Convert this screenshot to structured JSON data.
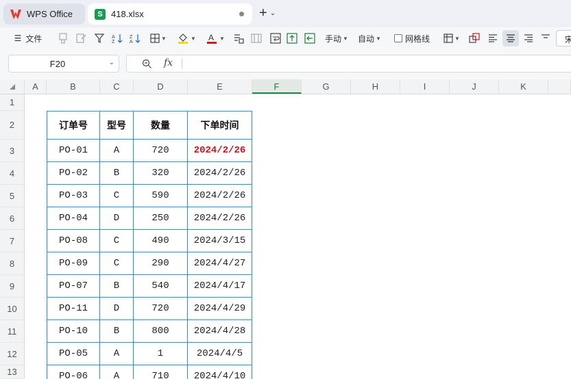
{
  "tabs": {
    "app_label": "WPS Office",
    "file_label": "418.xlsx",
    "file_icon": "S",
    "new_tab": "+"
  },
  "toolbar": {
    "file_menu": "文件",
    "manual": "手动",
    "auto": "自动",
    "gridlines": "网格线",
    "font_partial": "宋",
    "fill_color": "#f5d90a",
    "font_color": "#d0101a"
  },
  "formula_bar": {
    "name_box": "F20",
    "fx": "fx",
    "value": ""
  },
  "columns": [
    "A",
    "B",
    "C",
    "D",
    "E",
    "F",
    "G",
    "H",
    "I",
    "J",
    "K"
  ],
  "active_column": "F",
  "rows": [
    "1",
    "2",
    "3",
    "4",
    "5",
    "6",
    "7",
    "8",
    "9",
    "10",
    "11",
    "12",
    "13"
  ],
  "table": {
    "headers": [
      "订单号",
      "型号",
      "数量",
      "下单时间"
    ],
    "rows": [
      [
        "PO-01",
        "A",
        "720",
        "2024/2/26"
      ],
      [
        "PO-02",
        "B",
        "320",
        "2024/2/26"
      ],
      [
        "PO-03",
        "C",
        "590",
        "2024/2/26"
      ],
      [
        "PO-04",
        "D",
        "250",
        "2024/2/26"
      ],
      [
        "PO-08",
        "C",
        "490",
        "2024/3/15"
      ],
      [
        "PO-09",
        "C",
        "290",
        "2024/4/27"
      ],
      [
        "PO-07",
        "B",
        "540",
        "2024/4/17"
      ],
      [
        "PO-11",
        "D",
        "720",
        "2024/4/29"
      ],
      [
        "PO-10",
        "B",
        "800",
        "2024/4/28"
      ],
      [
        "PO-05",
        "A",
        "1",
        "2024/4/5"
      ],
      [
        "PO-06",
        "A",
        "710",
        "2024/4/10"
      ]
    ],
    "highlight_color": "#d0101a"
  }
}
